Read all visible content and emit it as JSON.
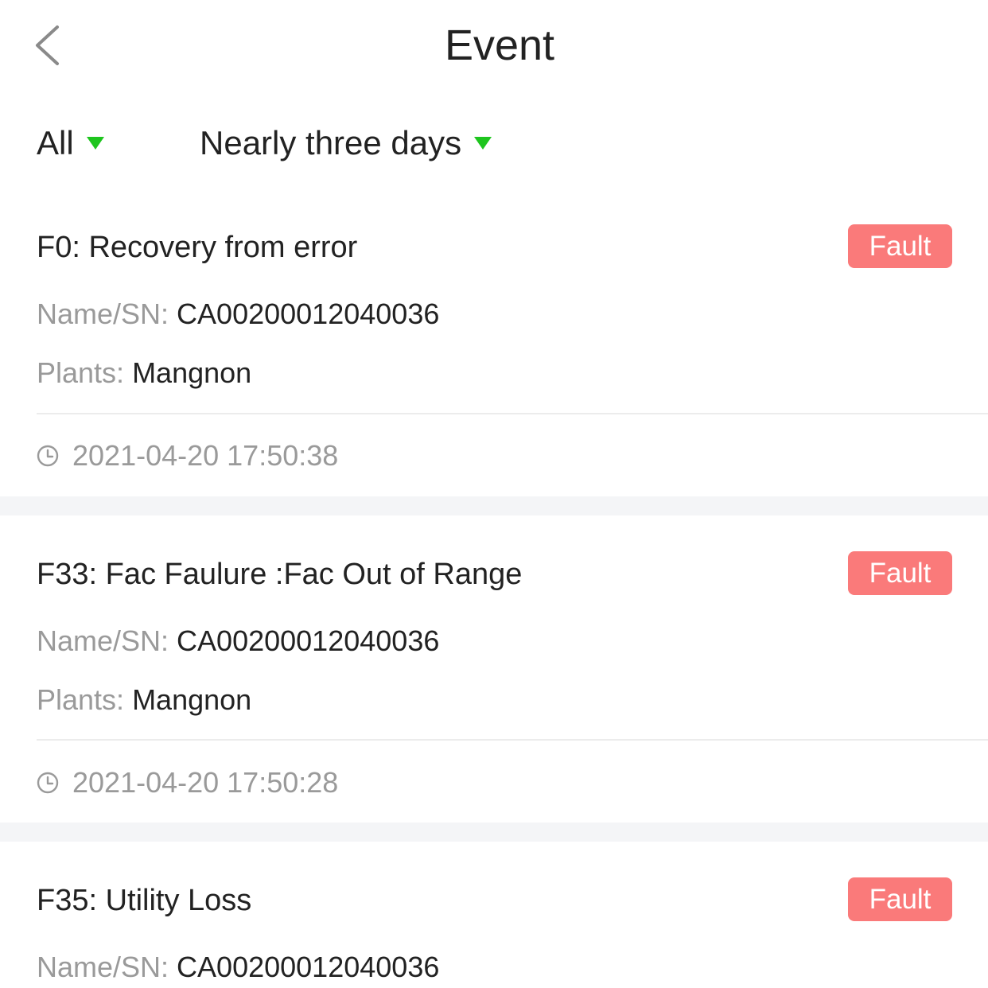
{
  "header": {
    "title": "Event",
    "back_icon": "chevron-left-icon"
  },
  "filters": {
    "type": {
      "label": "All",
      "caret_color": "#1ec51e"
    },
    "range": {
      "label": "Nearly three days",
      "caret_color": "#1ec51e"
    }
  },
  "colors": {
    "fault_badge": "#fa7a7a",
    "caret": "#1ec51e",
    "muted_text": "#9a9a9a",
    "gap_background": "#f4f5f7"
  },
  "events": [
    {
      "title": "F0: Recovery from error",
      "badge": "Fault",
      "name_sn_label": "Name/SN:",
      "name_sn_value": "CA00200012040036",
      "plants_label": "Plants:",
      "plants_value": "Mangnon",
      "time": "2021-04-20 17:50:38"
    },
    {
      "title": "F33: Fac Faulure :Fac Out of Range",
      "badge": "Fault",
      "name_sn_label": "Name/SN:",
      "name_sn_value": "CA00200012040036",
      "plants_label": "Plants:",
      "plants_value": "Mangnon",
      "time": "2021-04-20 17:50:28"
    },
    {
      "title": "F35: Utility Loss",
      "badge": "Fault",
      "name_sn_label": "Name/SN:",
      "name_sn_value": "CA00200012040036"
    }
  ]
}
